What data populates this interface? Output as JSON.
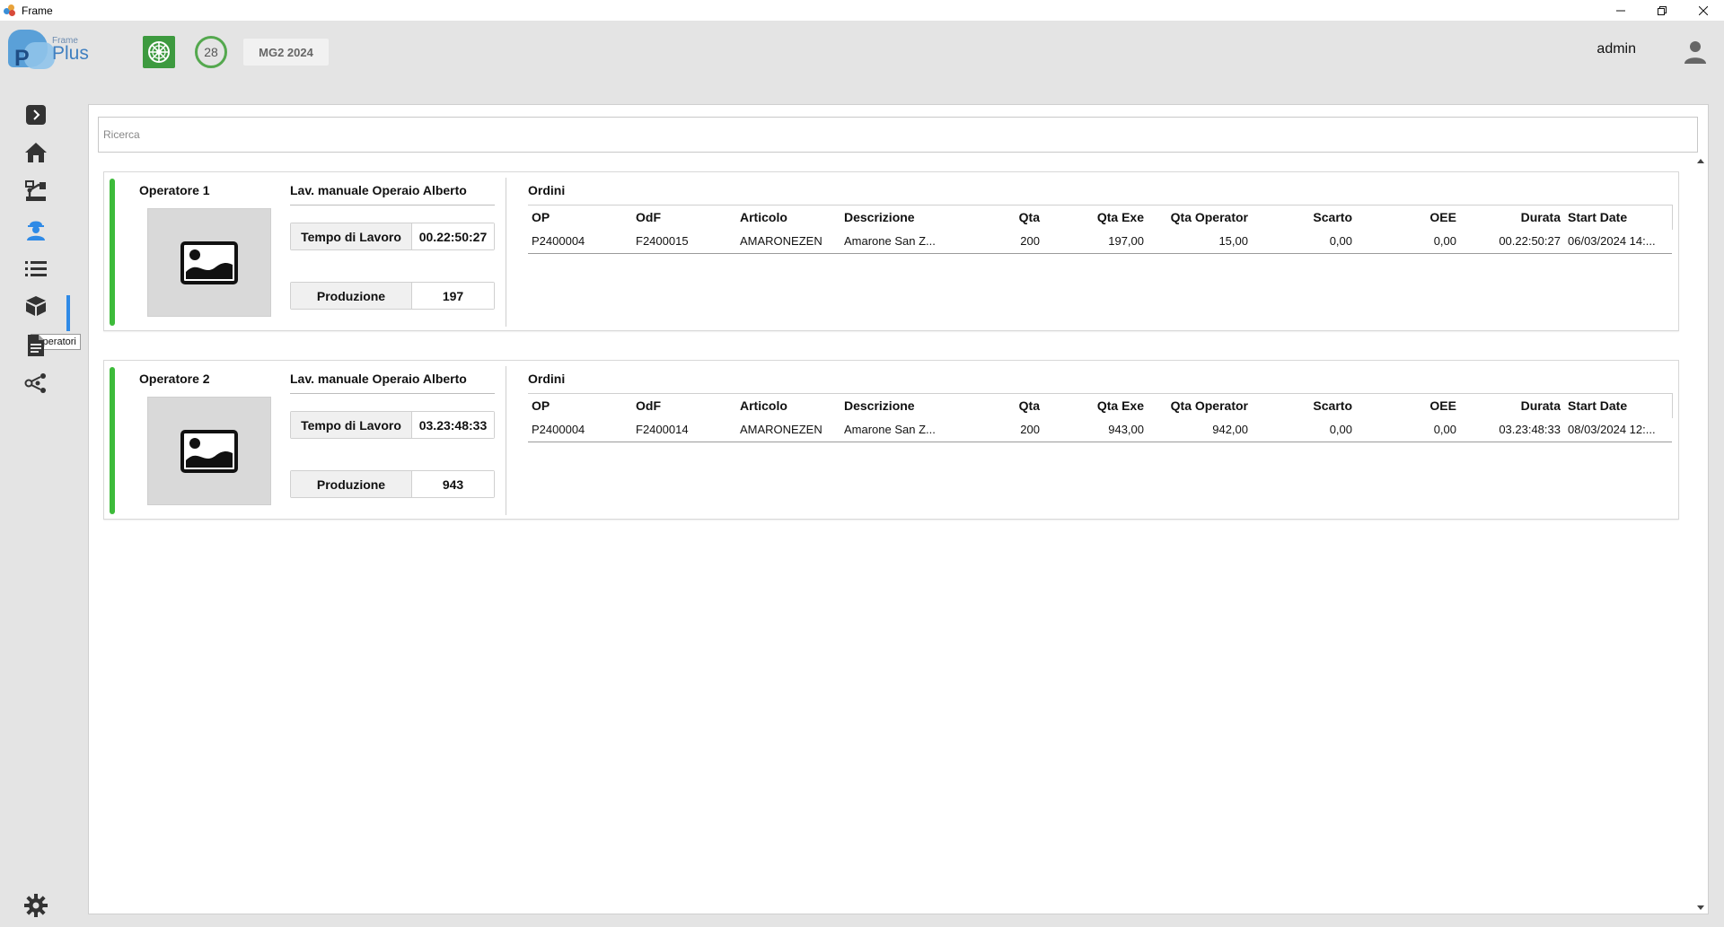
{
  "window": {
    "title": "Frame"
  },
  "header": {
    "logo_small": "Frame",
    "logo_plus": "Plus",
    "logo_p": "P",
    "badge_count": "28",
    "mg_label": "MG2 2024",
    "user_name": "admin"
  },
  "sidebar": {
    "items": [
      {
        "name": "expand",
        "icon": "chevron-right-icon"
      },
      {
        "name": "home",
        "icon": "home-icon"
      },
      {
        "name": "machines",
        "icon": "machine-icon"
      },
      {
        "name": "operatori",
        "icon": "worker-icon"
      },
      {
        "name": "list",
        "icon": "list-icon"
      },
      {
        "name": "products",
        "icon": "box-icon"
      },
      {
        "name": "documents",
        "icon": "document-icon"
      },
      {
        "name": "connections",
        "icon": "share-icon"
      }
    ],
    "tooltip": "Operatori",
    "settings_icon": "gear-icon",
    "accent": "#2f8ae6"
  },
  "search": {
    "placeholder": "Ricerca"
  },
  "operators": [
    {
      "name": "Operatore 1",
      "work": "Lav. manuale Operaio Alberto",
      "time_label": "Tempo di Lavoro",
      "time_value": "00.22:50:27",
      "prod_label": "Produzione",
      "prod_value": "197",
      "status_color": "#3dbb3a",
      "orders_title": "Ordini",
      "columns": [
        "OP",
        "OdF",
        "Articolo",
        "Descrizione",
        "Qta",
        "Qta Exe",
        "Qta Operator",
        "Scarto",
        "OEE",
        "Durata",
        "Start Date"
      ],
      "rows": [
        [
          "P2400004",
          "F2400015",
          "AMARONEZEN",
          "Amarone San Z...",
          "200",
          "197,00",
          "15,00",
          "0,00",
          "0,00",
          "00.22:50:27",
          "06/03/2024 14:..."
        ]
      ]
    },
    {
      "name": "Operatore 2",
      "work": "Lav. manuale Operaio Alberto",
      "time_label": "Tempo di Lavoro",
      "time_value": "03.23:48:33",
      "prod_label": "Produzione",
      "prod_value": "943",
      "status_color": "#3dbb3a",
      "orders_title": "Ordini",
      "columns": [
        "OP",
        "OdF",
        "Articolo",
        "Descrizione",
        "Qta",
        "Qta Exe",
        "Qta Operator",
        "Scarto",
        "OEE",
        "Durata",
        "Start Date"
      ],
      "rows": [
        [
          "P2400004",
          "F2400014",
          "AMARONEZEN",
          "Amarone San Z...",
          "200",
          "943,00",
          "942,00",
          "0,00",
          "0,00",
          "03.23:48:33",
          "08/03/2024 12:..."
        ]
      ]
    }
  ]
}
